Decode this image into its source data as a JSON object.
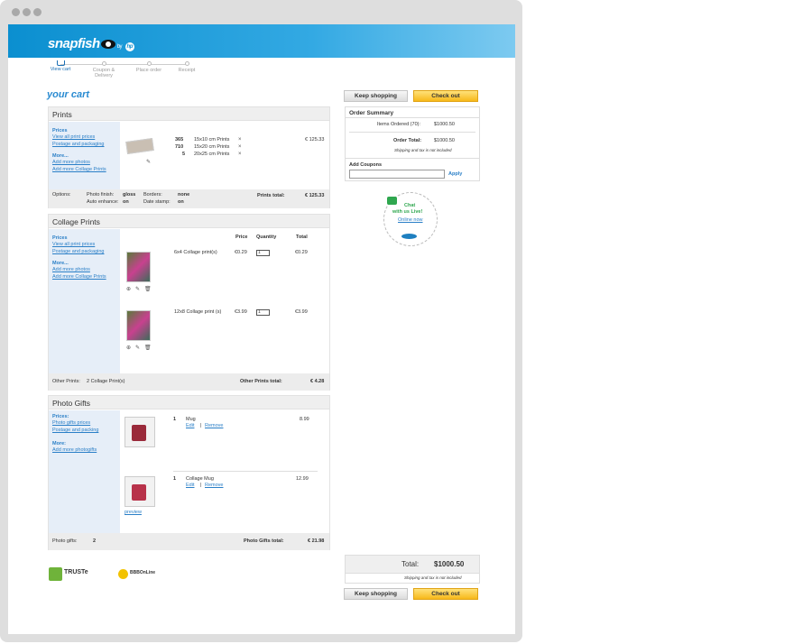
{
  "header": {
    "logo": "snapfish",
    "by": "by",
    "hp": "hp"
  },
  "steps": [
    {
      "label": "View cart",
      "active": true
    },
    {
      "label": "Coupon & Delivery",
      "active": false
    },
    {
      "label": "Place order",
      "active": false
    },
    {
      "label": "Receipt",
      "active": false
    }
  ],
  "title": "your cart",
  "buttons": {
    "keep_shopping": "Keep shopping",
    "check_out": "Check out"
  },
  "prints": {
    "heading": "Prints",
    "sidebar": {
      "prices": "Prices",
      "view_all": "View all print prices",
      "postage": "Postage and packaging",
      "more": "More...",
      "add_photos": "Add more photos",
      "add_collage": "Add more Collage Prints"
    },
    "rows": [
      {
        "qty": "365",
        "desc": "15x10 cm Prints"
      },
      {
        "qty": "710",
        "desc": "15x20 cm Prints"
      },
      {
        "qty": "5",
        "desc": "20x25 cm Prints"
      }
    ],
    "price": "€ 125.33",
    "footer": {
      "options": "Options:",
      "finish_label": "Photo finish:",
      "finish": "gloss",
      "borders_label": "Borders:",
      "borders": "none",
      "enhance_label": "Auto enhance:",
      "enhance": "on",
      "date_label": "Date stamp:",
      "date": "on",
      "total_label": "Prints total:",
      "total": "€ 125.33"
    }
  },
  "collage": {
    "heading": "Collage Prints",
    "sidebar": {
      "prices": "Prices",
      "view_all": "View all print prices",
      "postage": "Postage and packaging",
      "more": "More...",
      "add_photos": "Add more photos",
      "add_collage": "Add more Collage Prints"
    },
    "cols": {
      "price": "Price",
      "quantity": "Quantity",
      "total": "Total"
    },
    "items": [
      {
        "desc": "6x4 Collage print(s)",
        "price": "€0.29",
        "qty": "1",
        "total": "€0.29"
      },
      {
        "desc": "12x8 Collage print (s)",
        "price": "€3.99",
        "qty": "1",
        "total": "€3.99"
      }
    ],
    "footer": {
      "label": "Other Prints:",
      "count": "2 Collage Print(s)",
      "total_label": "Other Prints total:",
      "total": "€ 4.28"
    }
  },
  "gifts": {
    "heading": "Photo Gifts",
    "sidebar": {
      "prices": "Prices:",
      "gift_prices": "Photo gifts prices",
      "postage": "Postage and packing",
      "more": "More:",
      "add_more": "Add more photogifts"
    },
    "items": [
      {
        "qty": "1",
        "name": "Mug",
        "edit": "Edit",
        "remove": "Remove",
        "price": "8.99"
      },
      {
        "qty": "1",
        "name": "Collage Mug",
        "edit": "Edit",
        "remove": "Remove",
        "price": "12.99"
      }
    ],
    "preview": "preview",
    "footer": {
      "label": "Photo gifts:",
      "count": "2",
      "total_label": "Photo Gifts total:",
      "total": "€ 21.98"
    }
  },
  "summary": {
    "heading": "Order Summary",
    "items_label": "Items Ordered (70):",
    "items_value": "$1000.50",
    "total_label": "Order Total:",
    "total_value": "$1000.50",
    "note": "Shipping and tax is not included",
    "coupon_label": "Add Coupons",
    "apply": "Apply"
  },
  "chat": {
    "line1": "Chat",
    "line2": "with us Live!",
    "status": "Online now"
  },
  "total": {
    "label": "Total:",
    "value": "$1000.50",
    "note": "Shipping and tax is not included"
  },
  "badges": {
    "truste": "TRUSTe",
    "bbb": "BBBOnLine"
  },
  "colors": {
    "brand_blue": "#0b8fd0",
    "link": "#2a7fc7",
    "checkout": "#f7b81a"
  }
}
